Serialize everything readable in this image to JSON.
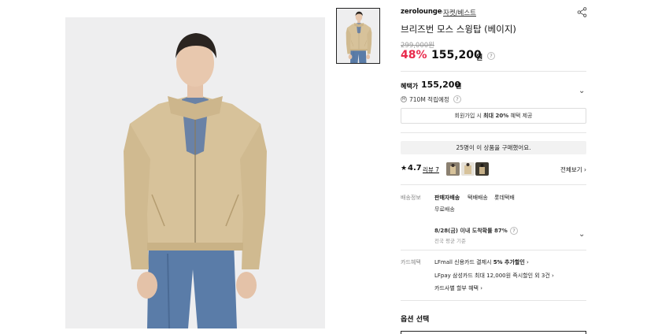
{
  "colors": {
    "discount": "#e8294b",
    "text": "#111111",
    "muted": "#999999",
    "border": "#e5e5e5"
  },
  "product": {
    "brand": "zerolounge",
    "category": "자켓/베스트",
    "title": "브리즈번 모스 스윙탑 (베이지)",
    "original_price": "299,000원",
    "discount_rate": "48%",
    "sale_price": "155,200",
    "currency": "원"
  },
  "benefit": {
    "label": "혜택가",
    "price": "155,200",
    "currency": "원",
    "points": "710M 적립예정",
    "member_text_pre": "회원가입 시 ",
    "member_text_bold": "최대 20%",
    "member_text_post": " 혜택 제공"
  },
  "buyers": "25명이 이 상품을 구매했어요.",
  "review": {
    "star": "★",
    "rating": "4.7",
    "review_link": "리뷰 7",
    "see_all": "전체보기 ›"
  },
  "shipping": {
    "label": "배송정보",
    "options": [
      "판매자배송",
      "택배배송",
      "롯데택배"
    ],
    "free": "무료배송",
    "arrival": "8/28(금) 이내 도착확률 87%",
    "arrival_note": "전국 평균 기준"
  },
  "card": {
    "label": "카드혜택",
    "line1_pre": "LFmall 신용카드 결제시 ",
    "line1_bold": "5% 추가할인",
    "line1_post": " ›",
    "line2": "LFpay 삼성카드 최대 12,000원 즉시할인 외 3건 ›",
    "line3": "카드사별 할부 혜택 ›"
  },
  "options_section": {
    "title": "옵션 선택"
  },
  "icons": {
    "share": "share-icon",
    "help": "question-icon",
    "chevron": "chevron-down-icon",
    "point": "point-icon"
  }
}
